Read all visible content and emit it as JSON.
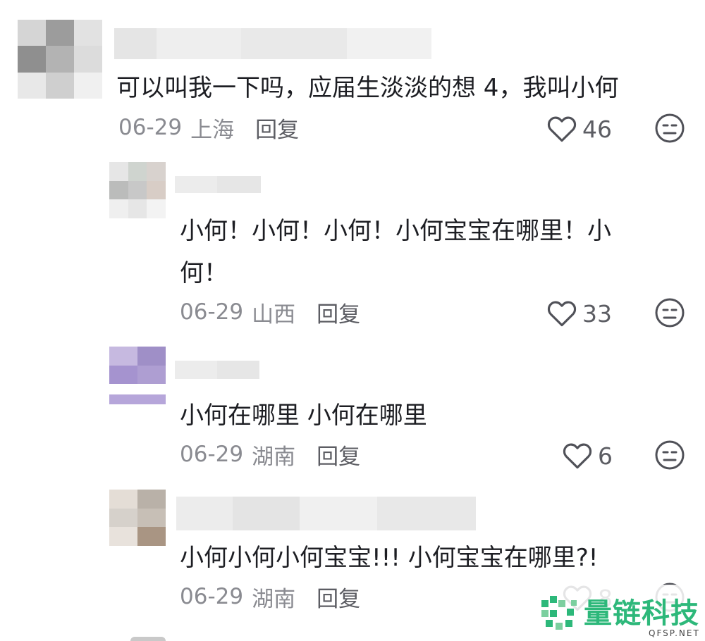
{
  "comments": [
    {
      "text": "可以叫我一下吗，应届生淡淡的想 4，我叫小何",
      "date": "06-29",
      "location": "上海",
      "reply_label": "回复",
      "likes": "46"
    },
    {
      "text": "小何！小何！小何！小何宝宝在哪里！小\n何！",
      "date": "06-29",
      "location": "山西",
      "reply_label": "回复",
      "likes": "33"
    },
    {
      "text": "小何在哪里 小何在哪里",
      "date": "06-29",
      "location": "湖南",
      "reply_label": "回复",
      "likes": "6"
    },
    {
      "text": "小何小何小何宝宝!!! 小何宝宝在哪里?!",
      "date": "06-29",
      "location": "湖南",
      "reply_label": "回复",
      "likes": "8"
    }
  ],
  "watermark": {
    "brand": "量链科技",
    "domain": "QFSP.NET"
  },
  "icons": {
    "like": "heart-outline-icon",
    "dislike": "unamused-face-icon"
  },
  "colors": {
    "meta_text": "#8a8b91",
    "watermark_green": "#2db87a"
  }
}
